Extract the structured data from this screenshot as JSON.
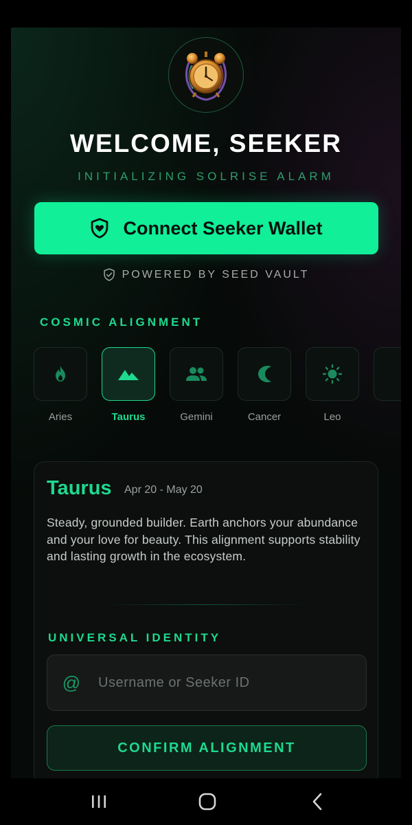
{
  "header": {
    "title": "WELCOME, SEEKER",
    "subtitle": "INITIALIZING SOLRISE ALARM"
  },
  "wallet": {
    "connect_label": "Connect Seeker Wallet",
    "powered_by": "POWERED BY SEED VAULT"
  },
  "cosmic": {
    "section_label": "COSMIC ALIGNMENT",
    "selected": "Taurus",
    "signs": [
      {
        "name": "Aries",
        "icon": "flame-icon"
      },
      {
        "name": "Taurus",
        "icon": "mountain-icon"
      },
      {
        "name": "Gemini",
        "icon": "people-icon"
      },
      {
        "name": "Cancer",
        "icon": "moon-icon"
      },
      {
        "name": "Leo",
        "icon": "sun-icon"
      }
    ]
  },
  "card": {
    "sign": "Taurus",
    "dates": "Apr 20 - May 20",
    "description": "Steady, grounded builder. Earth anchors your abundance and your love for beauty. This alignment supports stability and lasting growth in the ecosystem."
  },
  "identity": {
    "section_label": "UNIVERSAL IDENTITY",
    "placeholder": "Username or Seeker ID",
    "value": "",
    "confirm_label": "CONFIRM ALIGNMENT"
  },
  "colors": {
    "accent": "#11ef98",
    "accent_text": "#1ed98f",
    "background": "#060a08"
  }
}
